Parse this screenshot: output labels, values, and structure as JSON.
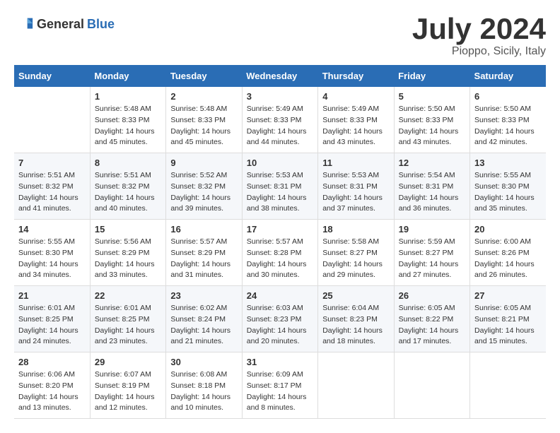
{
  "logo": {
    "general": "General",
    "blue": "Blue"
  },
  "title": "July 2024",
  "subtitle": "Pioppo, Sicily, Italy",
  "days_header": [
    "Sunday",
    "Monday",
    "Tuesday",
    "Wednesday",
    "Thursday",
    "Friday",
    "Saturday"
  ],
  "weeks": [
    [
      {
        "num": "",
        "sunrise": "",
        "sunset": "",
        "daylight": ""
      },
      {
        "num": "1",
        "sunrise": "Sunrise: 5:48 AM",
        "sunset": "Sunset: 8:33 PM",
        "daylight": "Daylight: 14 hours and 45 minutes."
      },
      {
        "num": "2",
        "sunrise": "Sunrise: 5:48 AM",
        "sunset": "Sunset: 8:33 PM",
        "daylight": "Daylight: 14 hours and 45 minutes."
      },
      {
        "num": "3",
        "sunrise": "Sunrise: 5:49 AM",
        "sunset": "Sunset: 8:33 PM",
        "daylight": "Daylight: 14 hours and 44 minutes."
      },
      {
        "num": "4",
        "sunrise": "Sunrise: 5:49 AM",
        "sunset": "Sunset: 8:33 PM",
        "daylight": "Daylight: 14 hours and 43 minutes."
      },
      {
        "num": "5",
        "sunrise": "Sunrise: 5:50 AM",
        "sunset": "Sunset: 8:33 PM",
        "daylight": "Daylight: 14 hours and 43 minutes."
      },
      {
        "num": "6",
        "sunrise": "Sunrise: 5:50 AM",
        "sunset": "Sunset: 8:33 PM",
        "daylight": "Daylight: 14 hours and 42 minutes."
      }
    ],
    [
      {
        "num": "7",
        "sunrise": "Sunrise: 5:51 AM",
        "sunset": "Sunset: 8:32 PM",
        "daylight": "Daylight: 14 hours and 41 minutes."
      },
      {
        "num": "8",
        "sunrise": "Sunrise: 5:51 AM",
        "sunset": "Sunset: 8:32 PM",
        "daylight": "Daylight: 14 hours and 40 minutes."
      },
      {
        "num": "9",
        "sunrise": "Sunrise: 5:52 AM",
        "sunset": "Sunset: 8:32 PM",
        "daylight": "Daylight: 14 hours and 39 minutes."
      },
      {
        "num": "10",
        "sunrise": "Sunrise: 5:53 AM",
        "sunset": "Sunset: 8:31 PM",
        "daylight": "Daylight: 14 hours and 38 minutes."
      },
      {
        "num": "11",
        "sunrise": "Sunrise: 5:53 AM",
        "sunset": "Sunset: 8:31 PM",
        "daylight": "Daylight: 14 hours and 37 minutes."
      },
      {
        "num": "12",
        "sunrise": "Sunrise: 5:54 AM",
        "sunset": "Sunset: 8:31 PM",
        "daylight": "Daylight: 14 hours and 36 minutes."
      },
      {
        "num": "13",
        "sunrise": "Sunrise: 5:55 AM",
        "sunset": "Sunset: 8:30 PM",
        "daylight": "Daylight: 14 hours and 35 minutes."
      }
    ],
    [
      {
        "num": "14",
        "sunrise": "Sunrise: 5:55 AM",
        "sunset": "Sunset: 8:30 PM",
        "daylight": "Daylight: 14 hours and 34 minutes."
      },
      {
        "num": "15",
        "sunrise": "Sunrise: 5:56 AM",
        "sunset": "Sunset: 8:29 PM",
        "daylight": "Daylight: 14 hours and 33 minutes."
      },
      {
        "num": "16",
        "sunrise": "Sunrise: 5:57 AM",
        "sunset": "Sunset: 8:29 PM",
        "daylight": "Daylight: 14 hours and 31 minutes."
      },
      {
        "num": "17",
        "sunrise": "Sunrise: 5:57 AM",
        "sunset": "Sunset: 8:28 PM",
        "daylight": "Daylight: 14 hours and 30 minutes."
      },
      {
        "num": "18",
        "sunrise": "Sunrise: 5:58 AM",
        "sunset": "Sunset: 8:27 PM",
        "daylight": "Daylight: 14 hours and 29 minutes."
      },
      {
        "num": "19",
        "sunrise": "Sunrise: 5:59 AM",
        "sunset": "Sunset: 8:27 PM",
        "daylight": "Daylight: 14 hours and 27 minutes."
      },
      {
        "num": "20",
        "sunrise": "Sunrise: 6:00 AM",
        "sunset": "Sunset: 8:26 PM",
        "daylight": "Daylight: 14 hours and 26 minutes."
      }
    ],
    [
      {
        "num": "21",
        "sunrise": "Sunrise: 6:01 AM",
        "sunset": "Sunset: 8:25 PM",
        "daylight": "Daylight: 14 hours and 24 minutes."
      },
      {
        "num": "22",
        "sunrise": "Sunrise: 6:01 AM",
        "sunset": "Sunset: 8:25 PM",
        "daylight": "Daylight: 14 hours and 23 minutes."
      },
      {
        "num": "23",
        "sunrise": "Sunrise: 6:02 AM",
        "sunset": "Sunset: 8:24 PM",
        "daylight": "Daylight: 14 hours and 21 minutes."
      },
      {
        "num": "24",
        "sunrise": "Sunrise: 6:03 AM",
        "sunset": "Sunset: 8:23 PM",
        "daylight": "Daylight: 14 hours and 20 minutes."
      },
      {
        "num": "25",
        "sunrise": "Sunrise: 6:04 AM",
        "sunset": "Sunset: 8:23 PM",
        "daylight": "Daylight: 14 hours and 18 minutes."
      },
      {
        "num": "26",
        "sunrise": "Sunrise: 6:05 AM",
        "sunset": "Sunset: 8:22 PM",
        "daylight": "Daylight: 14 hours and 17 minutes."
      },
      {
        "num": "27",
        "sunrise": "Sunrise: 6:05 AM",
        "sunset": "Sunset: 8:21 PM",
        "daylight": "Daylight: 14 hours and 15 minutes."
      }
    ],
    [
      {
        "num": "28",
        "sunrise": "Sunrise: 6:06 AM",
        "sunset": "Sunset: 8:20 PM",
        "daylight": "Daylight: 14 hours and 13 minutes."
      },
      {
        "num": "29",
        "sunrise": "Sunrise: 6:07 AM",
        "sunset": "Sunset: 8:19 PM",
        "daylight": "Daylight: 14 hours and 12 minutes."
      },
      {
        "num": "30",
        "sunrise": "Sunrise: 6:08 AM",
        "sunset": "Sunset: 8:18 PM",
        "daylight": "Daylight: 14 hours and 10 minutes."
      },
      {
        "num": "31",
        "sunrise": "Sunrise: 6:09 AM",
        "sunset": "Sunset: 8:17 PM",
        "daylight": "Daylight: 14 hours and 8 minutes."
      },
      {
        "num": "",
        "sunrise": "",
        "sunset": "",
        "daylight": ""
      },
      {
        "num": "",
        "sunrise": "",
        "sunset": "",
        "daylight": ""
      },
      {
        "num": "",
        "sunrise": "",
        "sunset": "",
        "daylight": ""
      }
    ]
  ]
}
